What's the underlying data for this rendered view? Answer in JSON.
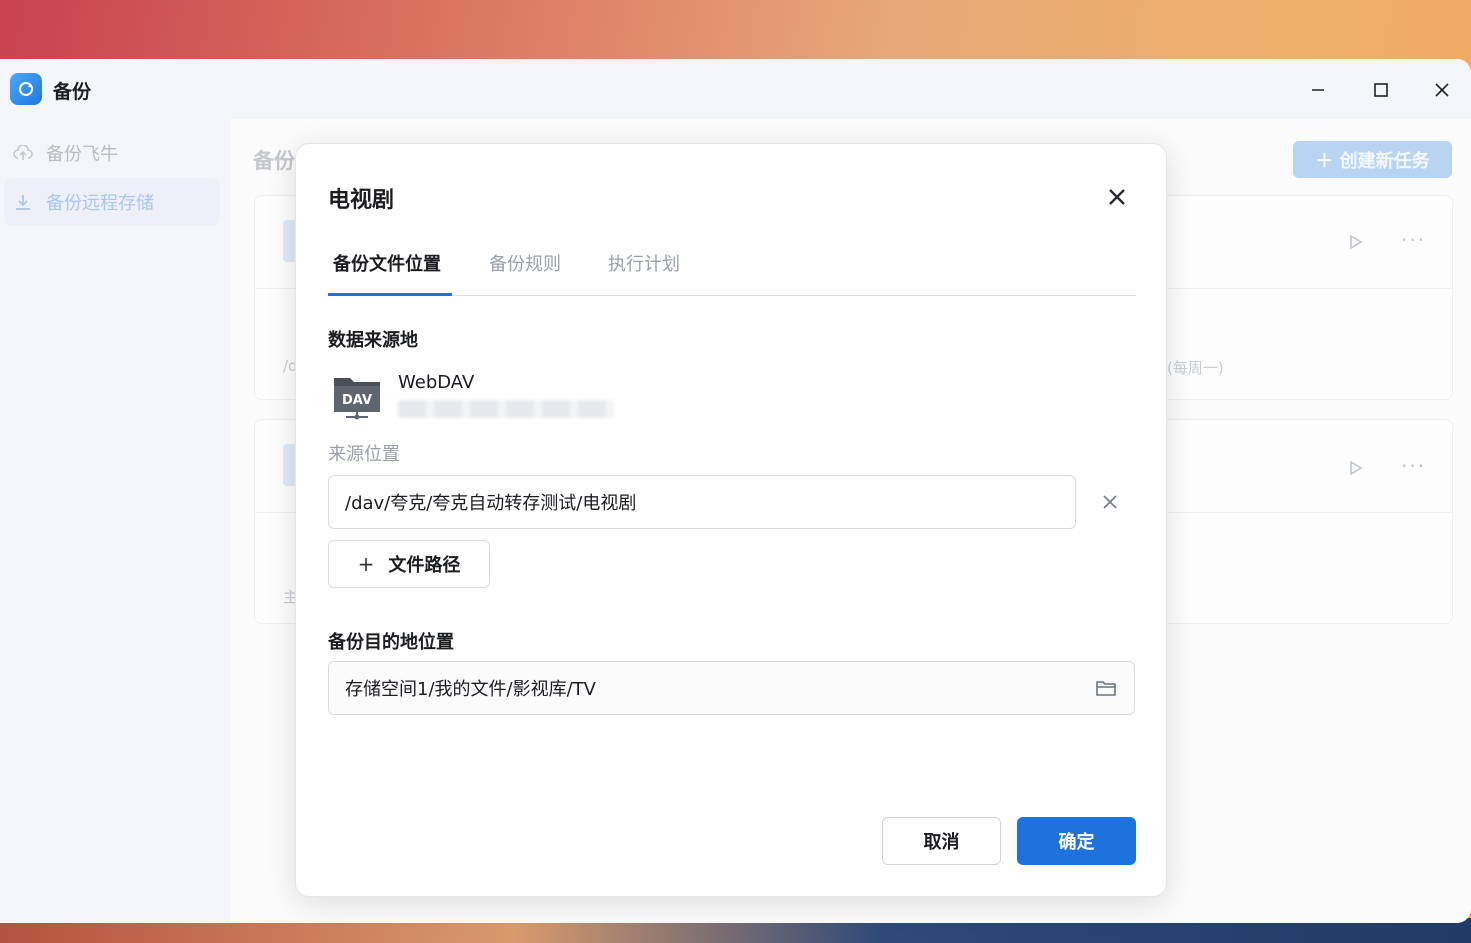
{
  "window": {
    "title": "备份",
    "controls": {
      "minimize": "—",
      "maximize": "☐",
      "close": "✕"
    }
  },
  "sidebar": {
    "items": [
      {
        "label": "备份飞牛",
        "icon": "cloud-upload-icon"
      },
      {
        "label": "备份远程存储",
        "icon": "download-icon",
        "active": true
      }
    ]
  },
  "main": {
    "title": "备份",
    "create_button": "＋ 创建新任务",
    "cards": [
      {
        "ghost_line1": "/d",
        "ghost_line2": "(每周一)"
      },
      {
        "ghost_line1": "主"
      }
    ]
  },
  "dialog": {
    "title": "电视剧",
    "close": "✕",
    "tabs": [
      {
        "label": "备份文件位置",
        "active": true
      },
      {
        "label": "备份规则"
      },
      {
        "label": "执行计划"
      }
    ],
    "source_section": "数据来源地",
    "source_type": "WebDAV",
    "source_icon_text": "DAV",
    "source_location_label": "来源位置",
    "source_path": "/dav/夸克/夸克自动转存测试/电视剧",
    "clear_icon": "✕",
    "add_path_plus": "+",
    "add_path_label": "文件路径",
    "dest_section": "备份目的地位置",
    "dest_path": "存储空间1/我的文件/影视库/TV",
    "cancel_label": "取消",
    "ok_label": "确定"
  },
  "colors": {
    "accent": "#1e72de",
    "accent_disabled": "#b9d4f3"
  }
}
